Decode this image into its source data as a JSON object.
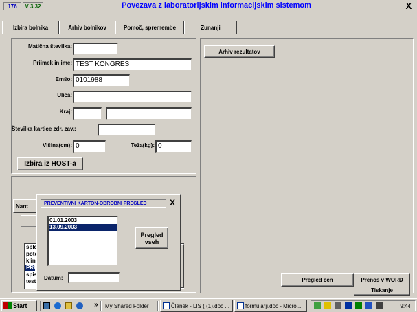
{
  "window": {
    "badge_number": "176",
    "version": "V 3.32",
    "title": "Povezava z laboratorijskim informacijskim sistemom",
    "close_glyph": "X"
  },
  "menu": [
    {
      "label": "Izbira bolnika"
    },
    {
      "label": "Arhiv bolnikov"
    },
    {
      "label": "Pomoč, spremembe"
    },
    {
      "label": "Zunanji"
    }
  ],
  "form": {
    "maticna_label": "Matična številka:",
    "maticna_value": "",
    "priimek_label": "Priimek in ime:",
    "priimek_value": "TEST KONGRES",
    "emso_label": "Emšo:",
    "emso_value": "0101988",
    "ulica_label": "Ulica:",
    "ulica_value": "",
    "kraj_label": "Kraj:",
    "kraj_post": "",
    "kraj_name": "",
    "kartica_label": "Številka kartice zdr. zav.:",
    "kartica_value": "",
    "visina_label": "Višina(cm):",
    "visina_value": "0",
    "teza_label": "Teža(kg):",
    "teza_value": "0",
    "host_button": "Izbira iz HOST-a"
  },
  "lower_panel": {
    "nar_button": "Narc",
    "list_items": [
      "splc",
      "potc",
      "klin",
      "PRE",
      "spis",
      "test"
    ],
    "selected_index": 3
  },
  "popup": {
    "title": "PREVENTIVNI KARTON-OBROBNI PREGLED",
    "close_glyph": "X",
    "dates": [
      "01.01.2003",
      "13.09.2003"
    ],
    "selected_index": 1,
    "pregled_button": "Pregled vseh",
    "datum_label": "Datum:",
    "datum_value": ""
  },
  "right_panel": {
    "arhiv_button": "Arhiv rezultatov",
    "pregled_cen_button": "Pregled cen",
    "prenos_button": "Prenos v WORD",
    "tiskanje_button": "Tiskanje"
  },
  "taskbar": {
    "start_label": "Start",
    "chevron": "»",
    "folder_label": "My Shared Folder",
    "tasks": [
      {
        "label": "Članek - LIS ( (1).doc ..."
      },
      {
        "label": "formularji.doc - Micro..."
      }
    ],
    "clock": "9:44"
  },
  "colors": {
    "title_text": "#0000ff",
    "selection": "#0a246a",
    "face": "#d4d0c8",
    "start_logo": "#c00000"
  }
}
